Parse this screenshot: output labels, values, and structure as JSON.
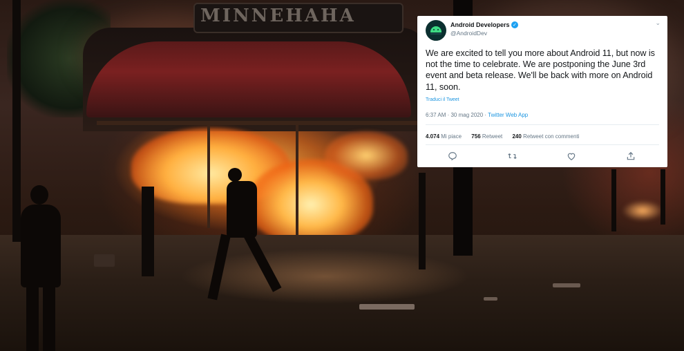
{
  "background": {
    "sign_text": "MINNEHAHA"
  },
  "tweet": {
    "author_name": "Android Developers",
    "handle": "@AndroidDev",
    "text": "We are excited to tell you more about Android 11, but now is not the time to celebrate. We are postponing the June 3rd event and beta release. We'll be back with more on Android 11, soon.",
    "translate_label": "Traduci il Tweet",
    "time": "6:37 AM · 30 mag 2020",
    "separator": " · ",
    "app": "Twitter Web App",
    "stats": {
      "likes_count": "4.074",
      "likes_label": "Mi piace",
      "retweets_count": "756",
      "retweets_label": "Retweet",
      "quotes_count": "240",
      "quotes_label": "Retweet con commenti"
    },
    "icons": {
      "verified": "verified-badge-icon",
      "more": "chevron-down-icon",
      "reply": "reply-icon",
      "retweet": "retweet-icon",
      "like": "heart-icon",
      "share": "share-icon"
    },
    "colors": {
      "link": "#1b95e0",
      "verified": "#1da1f2",
      "text": "#14171a",
      "muted": "#657786"
    }
  }
}
